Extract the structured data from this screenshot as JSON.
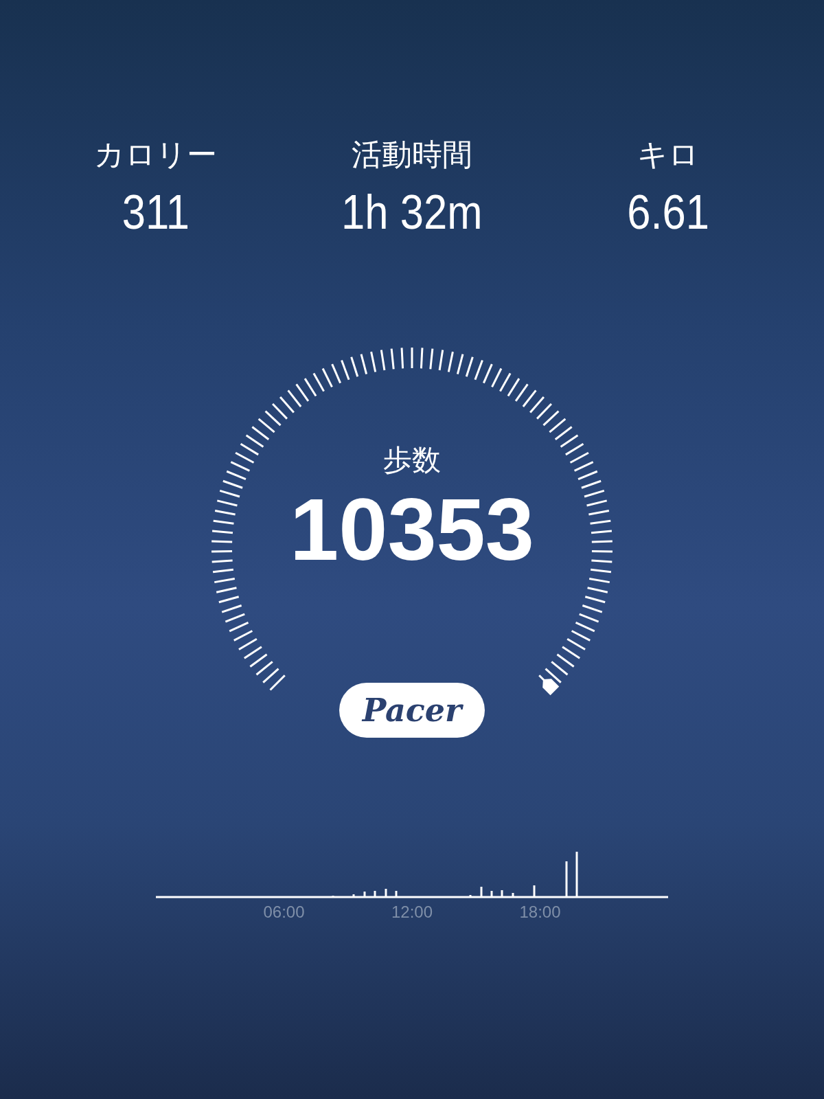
{
  "stats": [
    {
      "label": "カロリー",
      "value": "311"
    },
    {
      "label": "活動時間",
      "value": "1h 32m"
    },
    {
      "label": "キロ",
      "value": "6.61"
    }
  ],
  "steps": {
    "label": "歩数",
    "value": "10353"
  },
  "logo": {
    "text": "Pacer"
  },
  "activity_chart": {
    "time_labels": [
      "06:00",
      "12:00",
      "18:00"
    ]
  }
}
